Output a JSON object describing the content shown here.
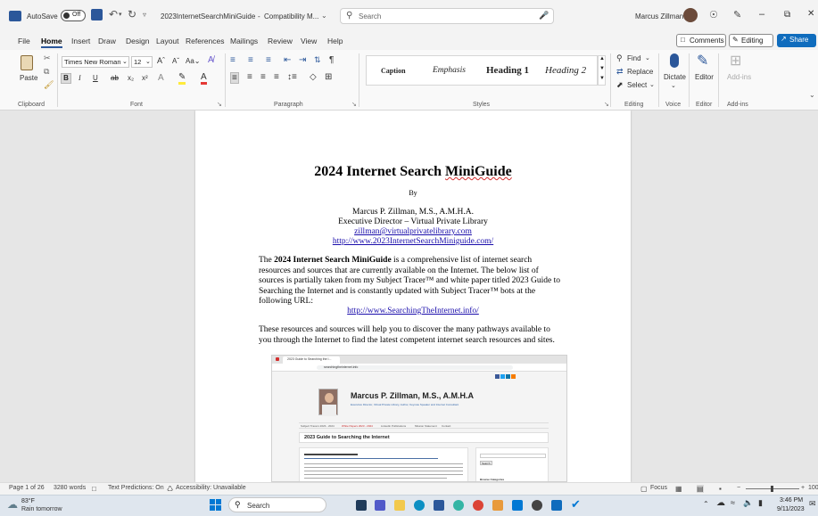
{
  "titlebar": {
    "autosave_label": "AutoSave",
    "autosave_state": "Off",
    "doc_title": "2023InternetSearchMiniGuide",
    "compat": "Compatibility M...",
    "search_placeholder": "Search",
    "user_name": "Marcus Zillman",
    "min_icon": "–",
    "max_icon": "⧉",
    "close_icon": "✕"
  },
  "menu": {
    "items": [
      "File",
      "Home",
      "Insert",
      "Draw",
      "Design",
      "Layout",
      "References",
      "Mailings",
      "Review",
      "View",
      "Help"
    ],
    "comments": "Comments",
    "editing": "Editing",
    "share": "Share"
  },
  "ribbon": {
    "paste": "Paste",
    "font_name": "Times New Roman",
    "font_size": "12",
    "styles": [
      "Caption",
      "Emphasis",
      "Heading 1",
      "Heading 2"
    ],
    "find": "Find",
    "replace": "Replace",
    "select": "Select",
    "dictate": "Dictate",
    "editor": "Editor",
    "addins": "Add-ins",
    "groups": {
      "clipboard": "Clipboard",
      "font": "Font",
      "paragraph": "Paragraph",
      "styles": "Styles",
      "editing": "Editing",
      "voice": "Voice",
      "editor": "Editor",
      "addins": "Add-ins"
    }
  },
  "document": {
    "title_pre": "2024 Internet Search ",
    "title_word": "MiniGuide",
    "by": "By",
    "author": "Marcus P. Zillman, M.S., A.M.H.A.",
    "role": "Executive Director – Virtual Private Library",
    "email": "zillman@virtualprivatelibrary.com",
    "url1": "http://www.2023InternetSearchMiniguide.com/",
    "para1_pre": "The ",
    "para1_bold1": "2024",
    "para1_bold2": " Internet Search MiniGuide",
    "para1_l1": " is a comprehensive list of internet search",
    "para1_l2": "resources and sources that are currently available on the Internet. The below list of",
    "para1_l3": "sources is partially taken from my Subject Tracer™ and white paper titled 2023 Guide to",
    "para1_l4": "Searching the Internet and is constantly updated with Subject Tracer™ bots at the",
    "para1_l5": "following URL:",
    "url2": "http://www.SearchingTheInternet.info/",
    "para2_l1": "These resources and sources will help you to discover the many pathways available to",
    "para2_l2": "you through the Internet to find the latest competent internet search resources and sites.",
    "shot": {
      "tab": "2023 Guide to Searching the I...",
      "address": "searchingtheinternet.info",
      "name": "Marcus P. Zillman, M.S., A.M.H.A",
      "sub": "Executive Director, Virtual Private Library, Author, Keynote Speaker and Internet Consultant",
      "nav": [
        "Subject Tracers 2023 - 2024",
        "White Papers 2023 - 2024",
        "Linkedin Publications",
        "Mission Statement",
        "Contact"
      ],
      "heading": "2023 Guide to Searching the Internet",
      "search_btn": "Search",
      "recent": "Browse Categories"
    }
  },
  "status": {
    "page": "Page 1 of 26",
    "words": "3280 words",
    "predictions": "Text Predictions: On",
    "accessibility": "Accessibility: Unavailable",
    "focus": "Focus",
    "zoom": "100"
  },
  "taskbar": {
    "weather_temp": "83°F",
    "weather_desc": "Rain tomorrow",
    "search": "Search",
    "time": "3:46 PM",
    "date": "9/11/2023"
  },
  "colors": {
    "accent": "#2b579a",
    "share": "#0f6cbd",
    "link": "#1a0dab"
  }
}
